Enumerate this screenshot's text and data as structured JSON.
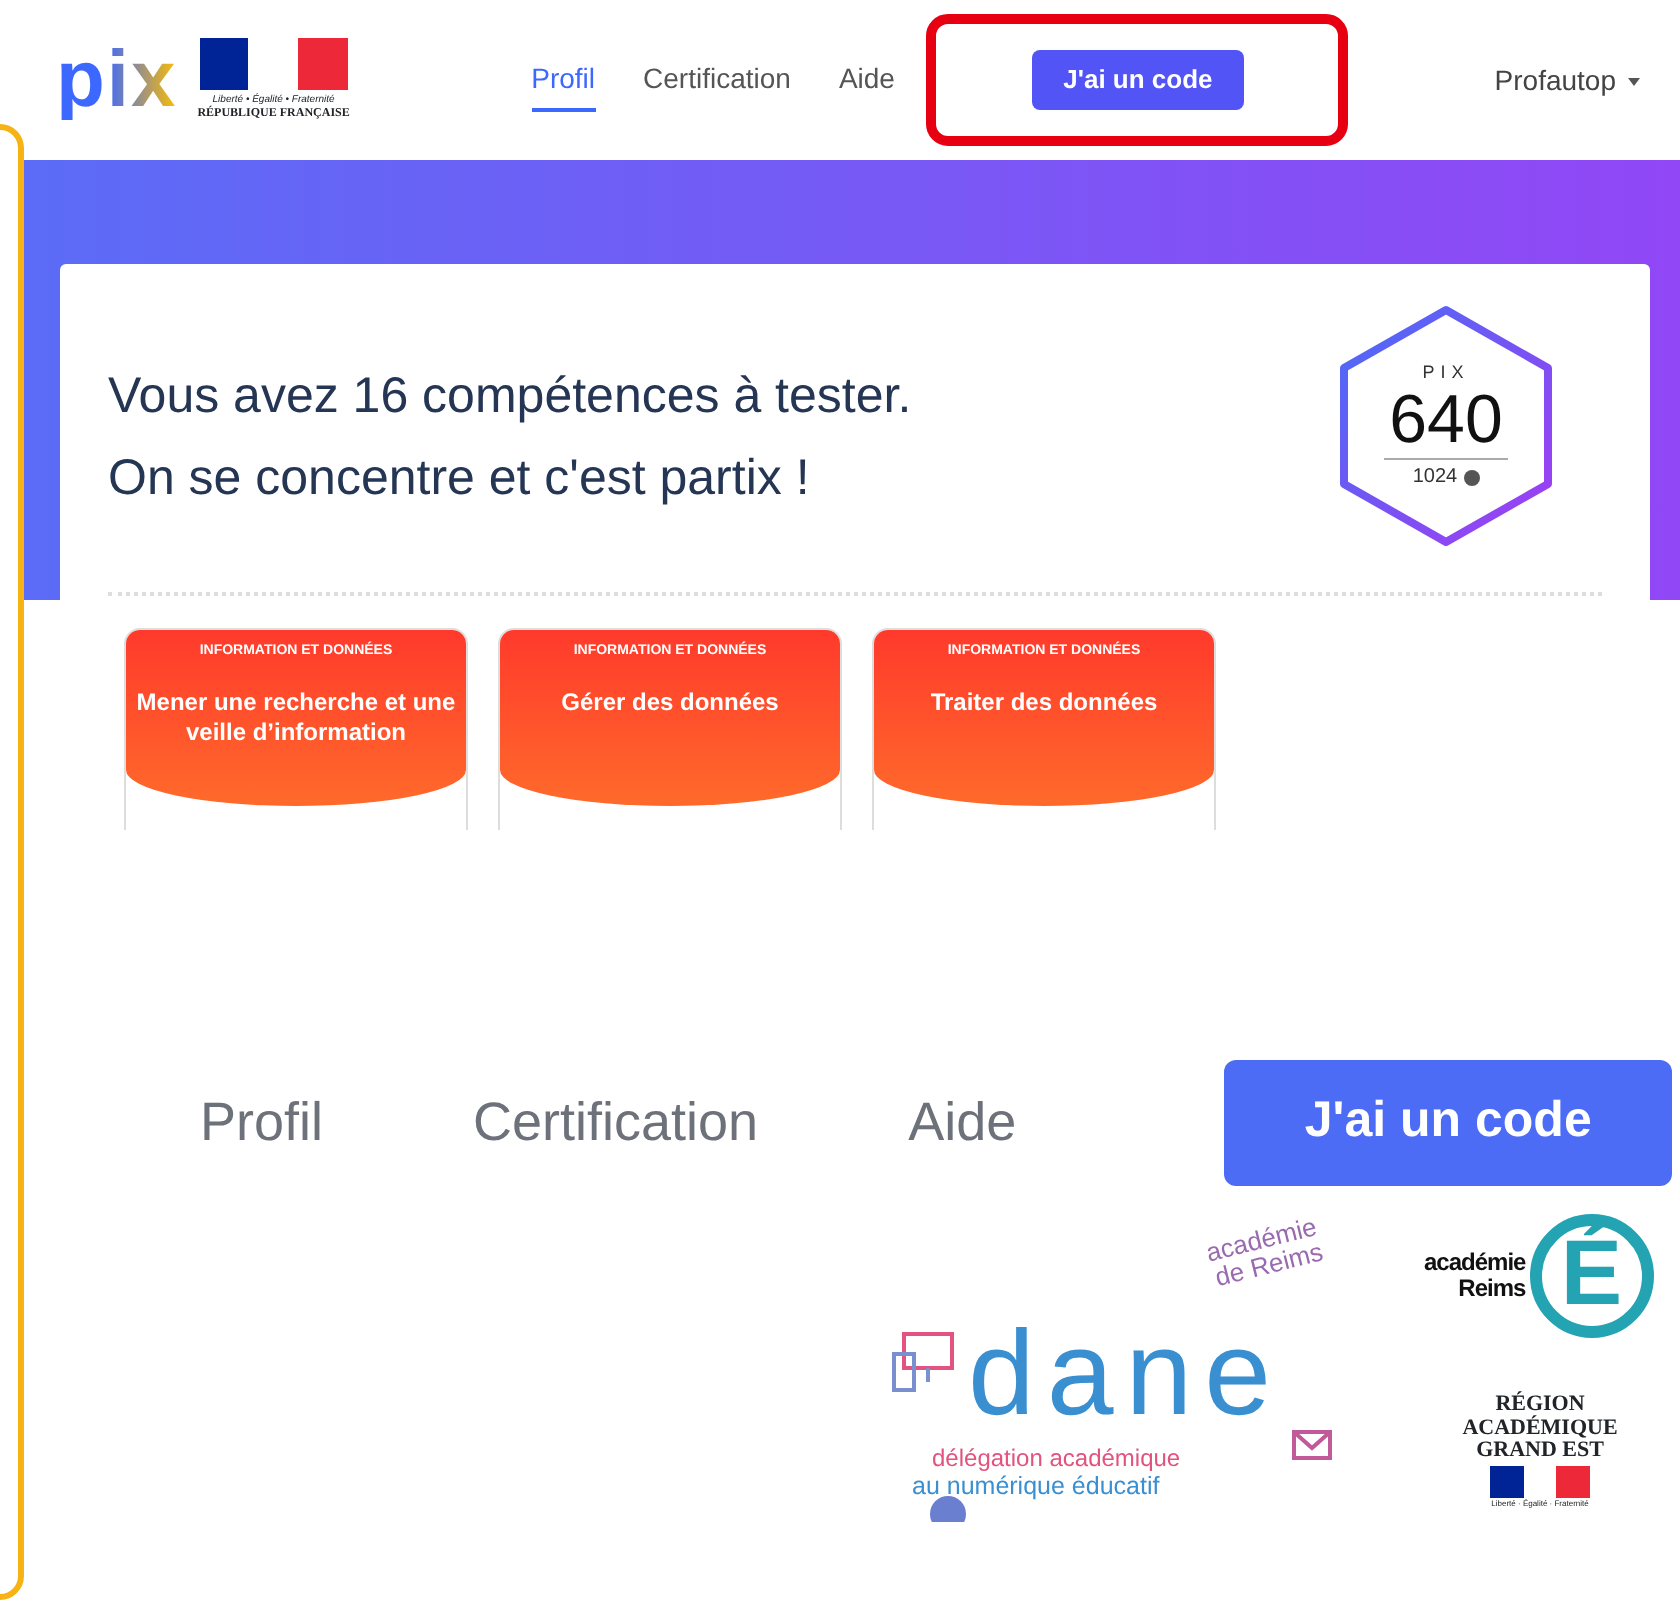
{
  "header": {
    "logo": "pix",
    "marianne": {
      "motto": "Liberté • Égalité • Fraternité",
      "name": "RÉPUBLIQUE FRANÇAISE"
    },
    "nav": [
      {
        "label": "Profil",
        "selected": true
      },
      {
        "label": "Certification",
        "selected": false
      },
      {
        "label": "Aide",
        "selected": false
      }
    ],
    "code_button": {
      "label": "J'ai un code",
      "highlighted": true
    },
    "user_menu": "Profautop"
  },
  "hero": {
    "lines": [
      "Vous avez 16 compétences à tester.",
      "On se concentre et c'est partix !"
    ],
    "score": {
      "label": "PIX",
      "value": "640",
      "max": "1024"
    }
  },
  "cards": [
    {
      "domain": "INFORMATION ET DONNÉES",
      "title": "Mener une recherche et une veille d’information"
    },
    {
      "domain": "INFORMATION ET DONNÉES",
      "title": "Gérer des données"
    },
    {
      "domain": "INFORMATION ET DONNÉES",
      "title": "Traiter des données"
    }
  ],
  "zoomed_nav": {
    "tabs": [
      "Profil",
      "Certification",
      "Aide"
    ],
    "button": "J'ai un code"
  },
  "logos": {
    "dane": {
      "word": "dane",
      "tag": [
        "académie",
        "de Reims"
      ],
      "lines": [
        "délégation académique",
        "au numérique éducatif"
      ]
    },
    "academie": {
      "lines": [
        "académie",
        "Reims"
      ],
      "letter": "É"
    },
    "region": [
      "RÉGION ACADÉMIQUE",
      "GRAND EST"
    ],
    "flag_motto": "Liberté · Égalité · Fraternité"
  }
}
